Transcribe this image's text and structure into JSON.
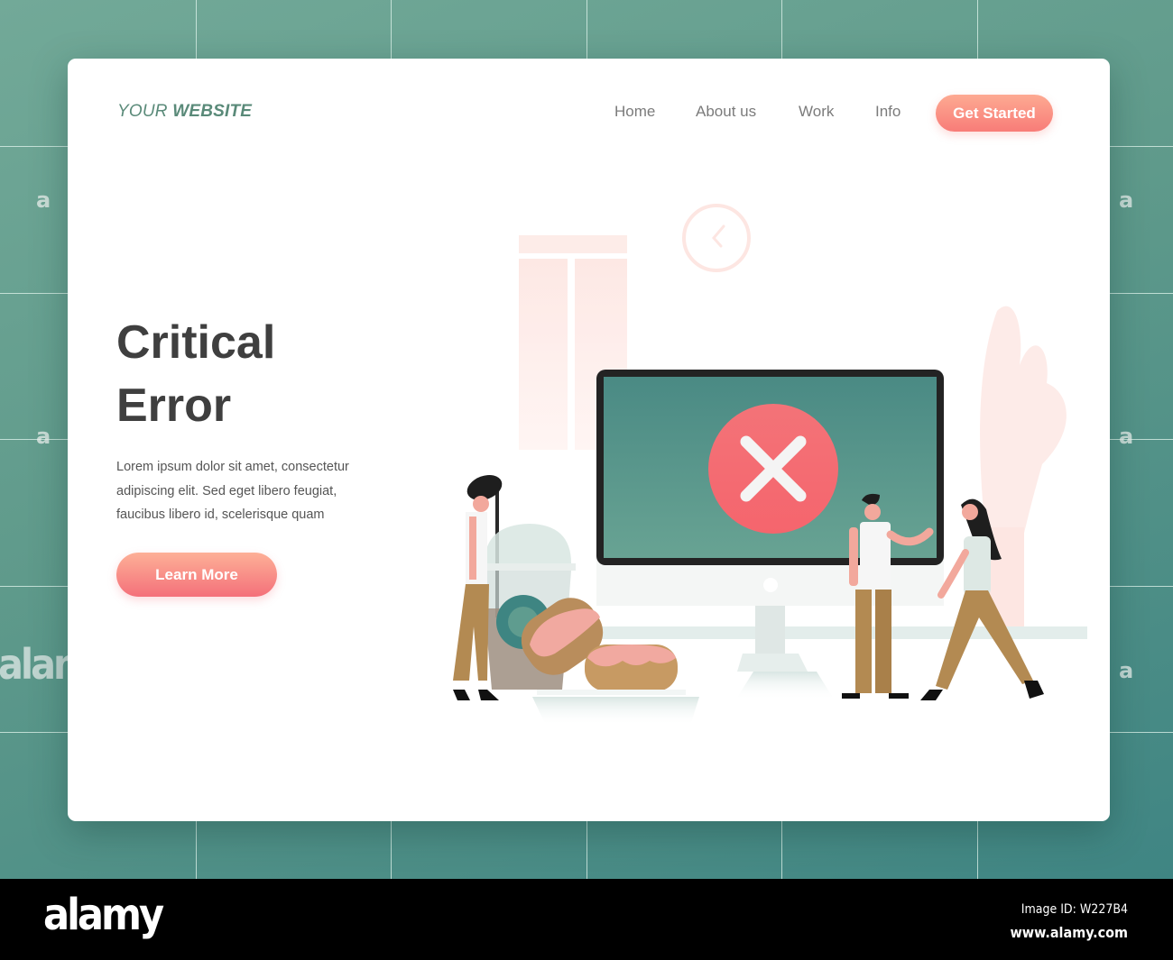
{
  "header": {
    "logo_light": "YOUR",
    "logo_bold": "WEBSITE",
    "nav": [
      {
        "label": "Home"
      },
      {
        "label": "About us"
      },
      {
        "label": "Work"
      },
      {
        "label": "Info"
      }
    ],
    "cta_label": "Get Started"
  },
  "hero": {
    "title_line1": "Critical",
    "title_line2": "Error",
    "body": "Lorem ipsum dolor sit amet, consectetur adipiscing elit. Sed eget libero feugiat, faucibus libero id, scelerisque quam",
    "button_label": "Learn More"
  },
  "illustration": {
    "screen_icon": "error-x-icon",
    "scene": "Three people around a large monitor showing a red X error symbol, with a drink cup and donuts"
  },
  "colors": {
    "brand_green": "#5a8a79",
    "accent_coral": "#f87c78",
    "screen_teal": "#4f8d85",
    "error_red": "#f2686e",
    "title_dark": "#3f3f3f"
  },
  "watermark": {
    "text_small": "a",
    "text_large": "alamy",
    "footer_logo": "alamy",
    "image_id": "Image ID: W227B4",
    "site": "www.alamy.com"
  }
}
